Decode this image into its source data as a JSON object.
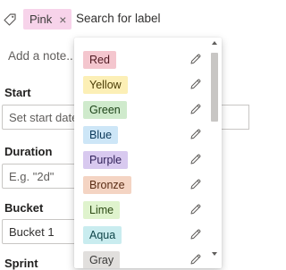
{
  "label_bar": {
    "tag_icon": "tag-icon",
    "selected_chip": {
      "label": "Pink",
      "remove_glyph": "×",
      "color": "#f7d3ea"
    },
    "search_placeholder": "Search for label"
  },
  "note": {
    "placeholder": "Add a note..."
  },
  "fields": {
    "start": {
      "label": "Start",
      "placeholder": "Set start date",
      "partial_right": "e"
    },
    "duration": {
      "label": "Duration",
      "placeholder": "E.g. \"2d\""
    },
    "bucket": {
      "label": "Bucket",
      "value": "Bucket 1"
    },
    "sprint": {
      "label": "Sprint"
    }
  },
  "dropdown": {
    "edit_icon": "pencil-icon",
    "labels": [
      {
        "name": "Red",
        "bg": "#f4c6ce",
        "fg": "#4f1a22"
      },
      {
        "name": "Yellow",
        "bg": "#fcefb6",
        "fg": "#4a3d06"
      },
      {
        "name": "Green",
        "bg": "#cfeacc",
        "fg": "#1e4319"
      },
      {
        "name": "Blue",
        "bg": "#cde6f7",
        "fg": "#0d3a5a"
      },
      {
        "name": "Purple",
        "bg": "#d8c9ef",
        "fg": "#31225a"
      },
      {
        "name": "Bronze",
        "bg": "#f4d4c3",
        "fg": "#5a2c15"
      },
      {
        "name": "Lime",
        "bg": "#dff3cd",
        "fg": "#2c4a14"
      },
      {
        "name": "Aqua",
        "bg": "#c9ecef",
        "fg": "#0f4549"
      },
      {
        "name": "Gray",
        "bg": "#e1dfdd",
        "fg": "#3b3a39"
      }
    ]
  }
}
